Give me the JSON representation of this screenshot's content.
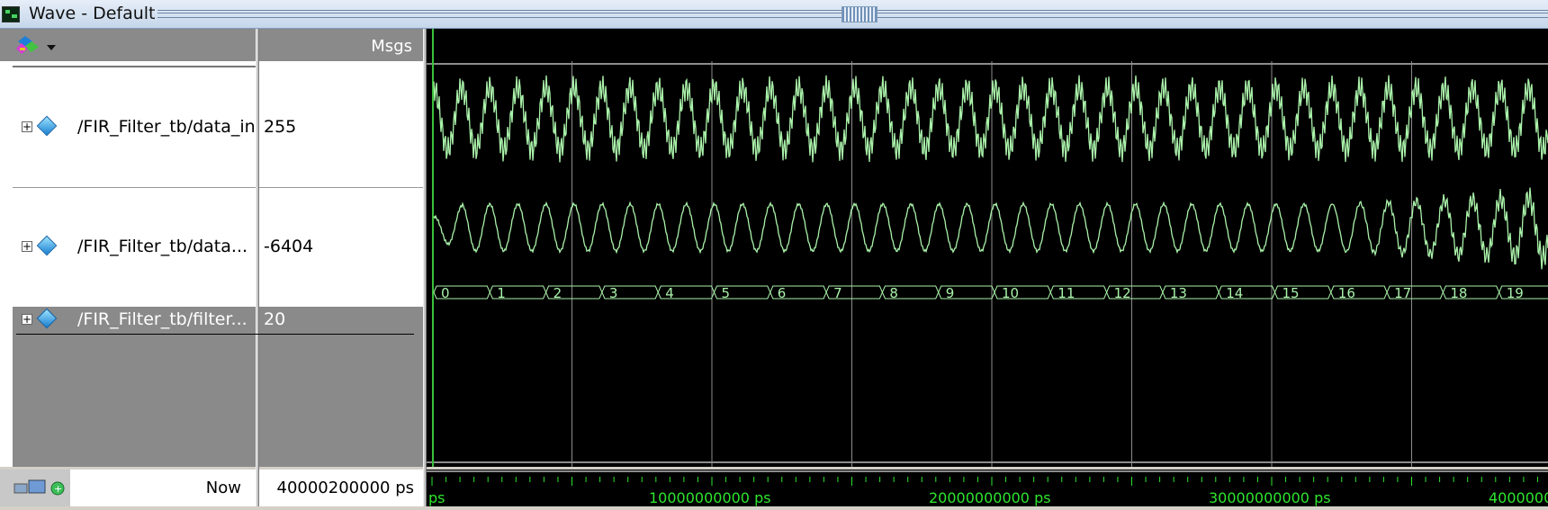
{
  "window": {
    "title": "Wave - Default"
  },
  "header": {
    "msgs_label": "Msgs",
    "tool_icon": "wave-toolbar-icon"
  },
  "signals": [
    {
      "name": "/FIR_Filter_tb/data_in",
      "value": "255",
      "icon": "signal-diamond-icon"
    },
    {
      "name": "/FIR_Filter_tb/data...",
      "value": "-6404",
      "icon": "signal-diamond-icon"
    },
    {
      "name": "/FIR_Filter_tb/filter...",
      "value": "20",
      "icon": "signal-diamond-icon",
      "selected": true
    }
  ],
  "bus_segments": [
    "0",
    "1",
    "2",
    "3",
    "4",
    "5",
    "6",
    "7",
    "8",
    "9",
    "10",
    "11",
    "12",
    "13",
    "14",
    "15",
    "16",
    "17",
    "18",
    "19"
  ],
  "footer": {
    "now_label": "Now",
    "now_value": "40000200000 ps"
  },
  "timeline": {
    "start_label": "ps",
    "labels": [
      "10000000000 ps",
      "20000000000 ps",
      "30000000000 ps",
      "4000000"
    ]
  },
  "colors": {
    "wave": "#aaf2aa",
    "background": "#000000",
    "grid": "#8c8c8c",
    "cursor": "#3cbf3c"
  }
}
